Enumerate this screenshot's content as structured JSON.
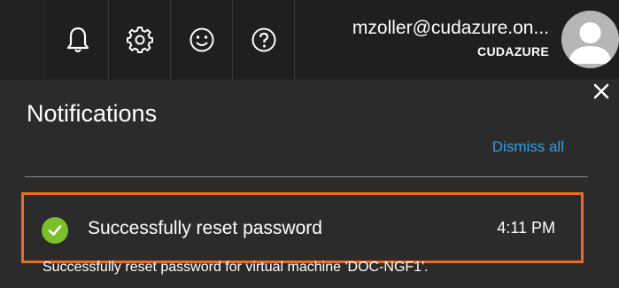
{
  "header": {
    "icons": [
      "bell-icon",
      "gear-icon",
      "smiley-icon",
      "help-icon"
    ],
    "user": {
      "email": "mzoller@cudazure.on...",
      "tenant": "CUDAZURE"
    }
  },
  "panel": {
    "title": "Notifications",
    "dismiss_all": "Dismiss all",
    "close_icon": "close-icon"
  },
  "notifications": [
    {
      "status": "success",
      "status_icon": "checkmark-icon",
      "title": "Successfully reset password",
      "time": "4:11 PM",
      "message": "Successfully reset password for virtual machine 'DOC-NGF1'."
    }
  ],
  "colors": {
    "accent_link": "#2fa4e7",
    "highlight_border": "#f06a1e",
    "success": "#7bbf2a"
  }
}
